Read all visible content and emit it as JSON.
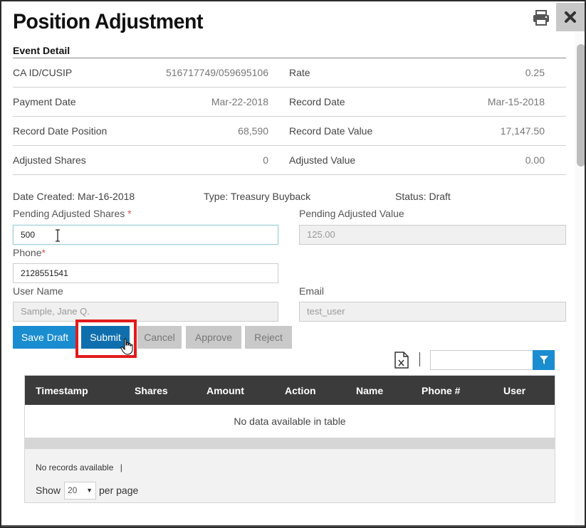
{
  "dialog": {
    "title": "Position Adjustment",
    "print_icon": "print-icon",
    "close_icon": "close-icon"
  },
  "event_detail": {
    "title": "Event Detail",
    "rows": [
      {
        "label1": "CA ID/CUSIP",
        "value1": "516717749/059695106",
        "label2": "Rate",
        "value2": "0.25"
      },
      {
        "label1": "Payment Date",
        "value1": "Mar-22-2018",
        "label2": "Record Date",
        "value2": "Mar-15-2018"
      },
      {
        "label1": "Record Date Position",
        "value1": "68,590",
        "label2": "Record Date Value",
        "value2": "17,147.50"
      },
      {
        "label1": "Adjusted Shares",
        "value1": "0",
        "label2": "Adjusted Value",
        "value2": "0.00"
      }
    ]
  },
  "meta": {
    "date_created": "Date Created: Mar-16-2018",
    "type": "Type: Treasury Buyback",
    "status": "Status: Draft"
  },
  "form": {
    "pending_shares_label": "Pending Adjusted Shares",
    "pending_shares_value": "500",
    "pending_value_label": "Pending Adjusted Value",
    "pending_value_value": "125.00",
    "phone_label": "Phone",
    "phone_value": "2128551541",
    "username_label": "User Name",
    "username_value": "Sample, Jane Q.",
    "email_label": "Email",
    "email_value": "test_user",
    "required_mark": "*"
  },
  "buttons": {
    "save_draft": "Save Draft",
    "submit": "Submit",
    "cancel": "Cancel",
    "approve": "Approve",
    "reject": "Reject"
  },
  "toolbar": {
    "export_icon": "excel-export-icon",
    "filter_icon": "filter-icon",
    "filter_value": ""
  },
  "grid": {
    "columns": [
      "Timestamp",
      "Shares",
      "Amount",
      "Action",
      "Name",
      "Phone #",
      "User"
    ],
    "empty_message": "No data available in table",
    "records_text": "No records available",
    "records_sep": "|",
    "show_label": "Show",
    "page_size": "20",
    "per_page_label": "per page"
  },
  "colors": {
    "primary": "#1a8dd1",
    "submit": "#0f6fae",
    "highlight": "#e21b1b",
    "header_bg": "#3b3b3b",
    "required": "#d9534f"
  }
}
